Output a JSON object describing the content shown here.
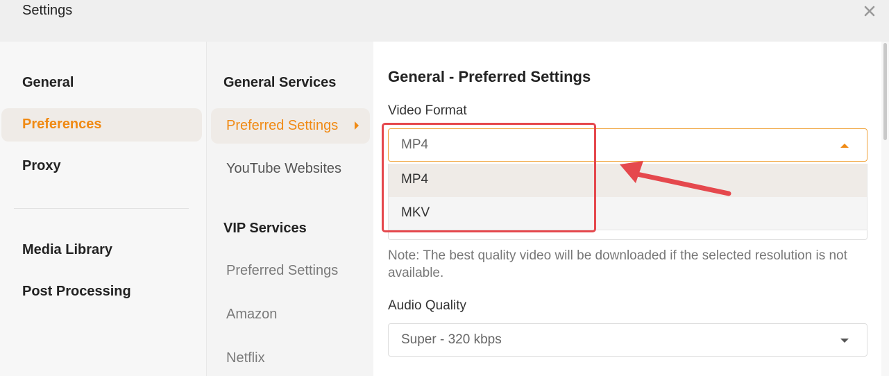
{
  "window": {
    "title": "Settings"
  },
  "sidebar_main": {
    "items": [
      {
        "label": "General"
      },
      {
        "label": "Preferences"
      },
      {
        "label": "Proxy"
      },
      {
        "label": "Media Library"
      },
      {
        "label": "Post Processing"
      }
    ],
    "active": "Preferences"
  },
  "sidebar_sub": {
    "general_heading": "General Services",
    "general_items": [
      {
        "label": "Preferred Settings"
      },
      {
        "label": "YouTube Websites"
      }
    ],
    "vip_heading": "VIP Services",
    "vip_items": [
      {
        "label": "Preferred Settings"
      },
      {
        "label": "Amazon"
      },
      {
        "label": "Netflix"
      }
    ],
    "active": "Preferred Settings"
  },
  "content": {
    "heading": "General - Preferred Settings",
    "video_format": {
      "label": "Video Format",
      "value": "MP4",
      "options": [
        "MP4",
        "MKV"
      ]
    },
    "note": "Note: The best quality video will be downloaded if the selected resolution is not available.",
    "audio_quality": {
      "label": "Audio Quality",
      "value": "Super - 320 kbps"
    }
  },
  "colors": {
    "accent": "#f08a14",
    "highlight": "#efebe7",
    "annotation": "#e5484d"
  },
  "icons": {
    "close": "close-icon",
    "submenu_arrow": "caret-right-icon",
    "select_open": "caret-up-icon",
    "select_closed": "caret-down-icon"
  }
}
